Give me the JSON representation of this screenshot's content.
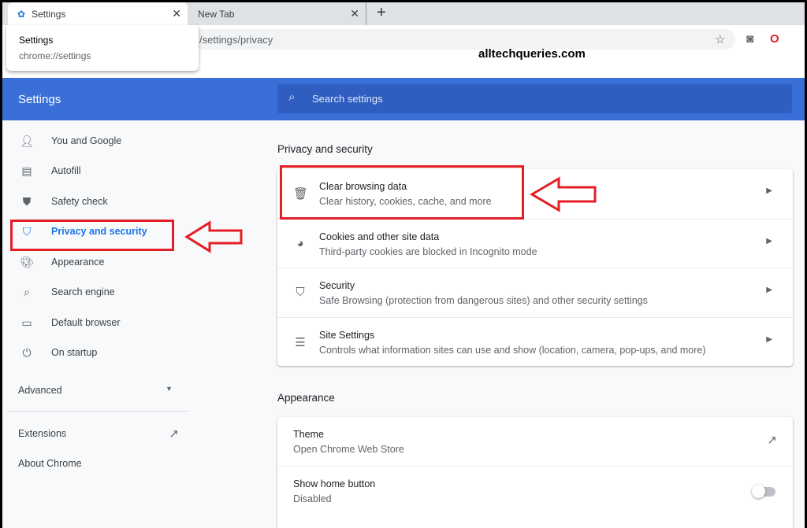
{
  "tabs": [
    {
      "label": "Settings",
      "icon": "gear-icon",
      "active": true
    },
    {
      "label": "New Tab",
      "active": false
    }
  ],
  "address": {
    "url": "/settings/privacy"
  },
  "tooltip": {
    "title": "Settings",
    "url": "chrome://settings"
  },
  "watermark": "alltechqueries.com",
  "header": {
    "title": "Settings",
    "search_placeholder": "Search settings"
  },
  "nav": {
    "items": [
      {
        "label": "You and Google",
        "icon": "person-icon"
      },
      {
        "label": "Autofill",
        "icon": "clipboard-icon"
      },
      {
        "label": "Safety check",
        "icon": "shield-check-icon"
      },
      {
        "label": "Privacy and security",
        "icon": "shield-icon",
        "selected": true
      },
      {
        "label": "Appearance",
        "icon": "palette-icon"
      },
      {
        "label": "Search engine",
        "icon": "search-icon"
      },
      {
        "label": "Default browser",
        "icon": "browser-icon"
      },
      {
        "label": "On startup",
        "icon": "power-icon"
      }
    ],
    "advanced": "Advanced",
    "extensions": "Extensions",
    "about": "About Chrome"
  },
  "privacy": {
    "title": "Privacy and security",
    "rows": [
      {
        "title": "Clear browsing data",
        "subtitle": "Clear history, cookies, cache, and more",
        "icon": "trash-icon"
      },
      {
        "title": "Cookies and other site data",
        "subtitle": "Third-party cookies are blocked in Incognito mode",
        "icon": "cookie-icon"
      },
      {
        "title": "Security",
        "subtitle": "Safe Browsing (protection from dangerous sites) and other security settings",
        "icon": "shield-icon"
      },
      {
        "title": "Site Settings",
        "subtitle": "Controls what information sites can use and show (location, camera, pop-ups, and more)",
        "icon": "sliders-icon"
      }
    ]
  },
  "appearance": {
    "title": "Appearance",
    "rows": [
      {
        "title": "Theme",
        "subtitle": "Open Chrome Web Store"
      },
      {
        "title": "Show home button",
        "subtitle": "Disabled",
        "toggle_on": false
      }
    ]
  },
  "colors": {
    "header": "#3a6fd8",
    "accent": "#1a73e8",
    "annotation": "#e41e26"
  }
}
